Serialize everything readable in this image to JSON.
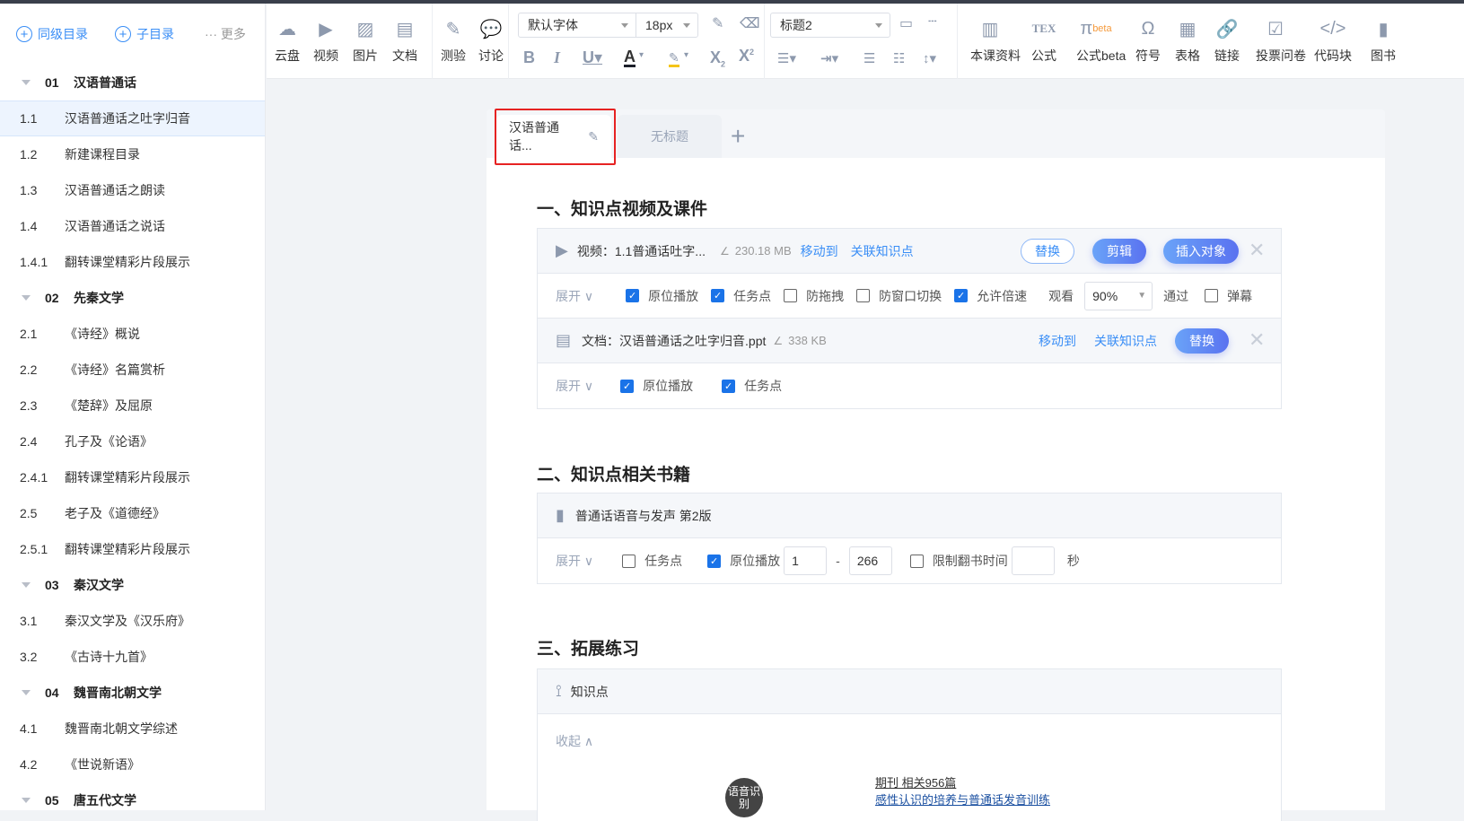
{
  "sidebar": {
    "actions": {
      "sibling": "同级目录",
      "child": "子目录",
      "more": "··· 更多"
    },
    "items": [
      {
        "num": "01",
        "label": "汉语普通话",
        "chapter": true
      },
      {
        "num": "1.1",
        "label": "汉语普通话之吐字归音",
        "active": true
      },
      {
        "num": "1.2",
        "label": "新建课程目录"
      },
      {
        "num": "1.3",
        "label": "汉语普通话之朗读"
      },
      {
        "num": "1.4",
        "label": "汉语普通话之说话"
      },
      {
        "num": "1.4.1",
        "label": "翻转课堂精彩片段展示"
      },
      {
        "num": "02",
        "label": "先秦文学",
        "chapter": true
      },
      {
        "num": "2.1",
        "label": "《诗经》概说"
      },
      {
        "num": "2.2",
        "label": "《诗经》名篇赏析"
      },
      {
        "num": "2.3",
        "label": "《楚辞》及屈原"
      },
      {
        "num": "2.4",
        "label": "孔子及《论语》"
      },
      {
        "num": "2.4.1",
        "label": "翻转课堂精彩片段展示"
      },
      {
        "num": "2.5",
        "label": "老子及《道德经》"
      },
      {
        "num": "2.5.1",
        "label": "翻转课堂精彩片段展示"
      },
      {
        "num": "03",
        "label": "秦汉文学",
        "chapter": true
      },
      {
        "num": "3.1",
        "label": "秦汉文学及《汉乐府》"
      },
      {
        "num": "3.2",
        "label": "《古诗十九首》"
      },
      {
        "num": "04",
        "label": "魏晋南北朝文学",
        "chapter": true
      },
      {
        "num": "4.1",
        "label": "魏晋南北朝文学综述"
      },
      {
        "num": "4.2",
        "label": "《世说新语》"
      },
      {
        "num": "05",
        "label": "唐五代文学",
        "chapter": true
      }
    ]
  },
  "toolbar": {
    "insert": [
      {
        "label": "云盘",
        "icon": "cloud-icon"
      },
      {
        "label": "视频",
        "icon": "video-icon"
      },
      {
        "label": "图片",
        "icon": "image-icon"
      },
      {
        "label": "文档",
        "icon": "document-icon"
      }
    ],
    "activity": [
      {
        "label": "测验",
        "icon": "quiz-icon"
      },
      {
        "label": "讨论",
        "icon": "discussion-icon"
      }
    ],
    "font_family": "默认字体",
    "font_size": "18px",
    "heading": "标题2",
    "tools": [
      {
        "label": "本课资料",
        "icon": "book-open-icon"
      },
      {
        "label": "公式",
        "icon": "tex-icon"
      },
      {
        "label": "公式beta",
        "icon": "pi-icon",
        "badge": "beta"
      },
      {
        "label": "符号",
        "icon": "omega-icon"
      },
      {
        "label": "表格",
        "icon": "table-icon"
      },
      {
        "label": "链接",
        "icon": "link-icon"
      },
      {
        "label": "投票问卷",
        "icon": "vote-icon"
      },
      {
        "label": "代码块",
        "icon": "code-icon"
      },
      {
        "label": "图书",
        "icon": "book-icon"
      }
    ]
  },
  "tabs": [
    {
      "label": "汉语普通话..."
    },
    {
      "label": "无标题"
    }
  ],
  "sections": {
    "s1": {
      "title": "一、知识点视频及课件",
      "video": {
        "title": "视频：1.1普通话吐字...",
        "size": "230.18 MB",
        "move": "移动到",
        "link": "关联知识点",
        "replace": "替换",
        "edit": "剪辑",
        "insert": "插入对象",
        "expand": "展开",
        "opts": [
          {
            "label": "原位播放",
            "checked": true
          },
          {
            "label": "任务点",
            "checked": true
          },
          {
            "label": "防拖拽",
            "checked": false
          },
          {
            "label": "防窗口切换",
            "checked": false
          },
          {
            "label": "允许倍速",
            "checked": true
          }
        ],
        "watch_label": "观看",
        "watch_value": "90%",
        "pass_label": "通过",
        "danmu": {
          "label": "弹幕",
          "checked": false
        }
      },
      "doc": {
        "title": "文档：汉语普通话之吐字归音.ppt",
        "size": "338 KB",
        "move": "移动到",
        "link": "关联知识点",
        "replace": "替换",
        "expand": "展开",
        "opts": [
          {
            "label": "原位播放",
            "checked": true
          },
          {
            "label": "任务点",
            "checked": true
          }
        ]
      }
    },
    "s2": {
      "title": "二、知识点相关书籍",
      "book": {
        "title": "普通话语音与发声 第2版",
        "expand": "展开",
        "task": {
          "label": "任务点",
          "checked": false
        },
        "inplace": {
          "label": "原位播放",
          "checked": true
        },
        "page_from": "1",
        "dash": "-",
        "page_to": "266",
        "limit": {
          "label": "限制翻书时间",
          "checked": false
        },
        "seconds_value": "",
        "seconds_unit": "秒"
      }
    },
    "s3": {
      "title": "三、拓展练习",
      "kp": {
        "title": "知识点",
        "collapse": "收起",
        "node": "语音识别",
        "journal": "期刊  相关956篇",
        "article": "感性认识的培养与普通话发音训练"
      }
    }
  }
}
